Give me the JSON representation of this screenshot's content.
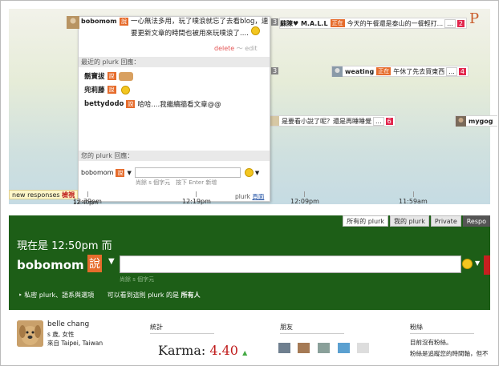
{
  "timeline": {
    "brand_letter": "P",
    "bubbles": [
      {
        "nick": "蘇陳♥ M.A.L.L",
        "qual": "正在",
        "text": "今天的午餐還是泰山的一餐輕打...",
        "more": "...",
        "count": "2"
      },
      {
        "nick": "weating",
        "qual": "正在",
        "text": "午休了先去買東西",
        "more": "...",
        "count": "4"
      },
      {
        "text": "是要看小說了呢？還是再睡睡覺",
        "more": "...",
        "count": "6"
      },
      {
        "nick": "mygog"
      }
    ],
    "left_counts": [
      "3",
      "3"
    ],
    "ticks": [
      "12:39pm",
      "12:19pm",
      "12:09pm",
      "11:59am"
    ],
    "tick_label_small": "12:40pm",
    "new_responses": "new responses",
    "new_responses_action": "檢視"
  },
  "popup": {
    "nick": "bobomom",
    "qual": "說",
    "text": "一心無法多用，玩了噗浪就忘了去看blog，連要更新文章的時間也被用來玩噗浪了....",
    "close": "×",
    "delete_label": "delete",
    "edit_label": "edit",
    "recent_header": "最近的 plurk 回應：",
    "responses": [
      {
        "nick": "鬍寶拔",
        "qual": "說",
        "text": ""
      },
      {
        "nick": "兜莉藤",
        "qual": "說",
        "text": ""
      },
      {
        "nick": "bettydodo",
        "qual": "說",
        "text": "哈哈....我繼續牆看文章@@"
      }
    ],
    "your_header": "您的 plurk 回應：",
    "reply_nick": "bobomom",
    "reply_qual": "說",
    "hint": "尚餘 s 個字元　按下 Enter 新增",
    "footer_label": "plurk",
    "footer_link": "頁面"
  },
  "form": {
    "tabs": [
      "所有的 plurk",
      "我的 plurk",
      "Private",
      "Respo"
    ],
    "now_text": "現在是 12:50pm 而",
    "nick": "bobomom",
    "qual": "說",
    "input_value": "",
    "hint": "尚餘 s 個字元",
    "options_link": "‣ 私密 plurk、語系與選項",
    "who_prefix": "可以看到這則 plurk 的是",
    "who_value": "所有人"
  },
  "profile": {
    "name": "belle chang",
    "age_gender": "s 歲, 女性",
    "location": "來自 Taipei, Taiwan",
    "stats_title": "統計",
    "karma_label": "Karma:",
    "karma_value": "4.40",
    "karma_trend": "▲",
    "friends_title": "朋友",
    "fans_title": "粉絲",
    "fans_text1": "目前沒有粉絲。",
    "fans_text2": "粉絲是追蹤您的時間軸，但不"
  }
}
